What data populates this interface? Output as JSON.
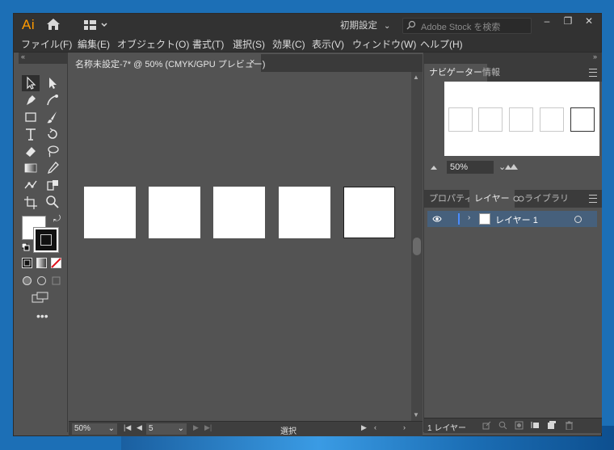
{
  "app": {
    "logo": "Ai",
    "workspace_preset": "初期設定",
    "search_placeholder": "Adobe Stock を検索"
  },
  "menu": [
    "ファイル(F)",
    "編集(E)",
    "オブジェクト(O)",
    "書式(T)",
    "選択(S)",
    "効果(C)",
    "表示(V)",
    "ウィンドウ(W)",
    "ヘルプ(H)"
  ],
  "document": {
    "tab_title": "名称未設定-7* @ 50% (CMYK/GPU プレビュー)",
    "close_glyph": "×"
  },
  "status": {
    "zoom": "50%",
    "artboard": "5",
    "mode": "選択"
  },
  "navigator": {
    "tabs": [
      "ナビゲーター",
      "情報"
    ],
    "zoom": "50%"
  },
  "layers_panel": {
    "tabs": [
      "プロパティ",
      "レイヤー",
      "ライブラリ"
    ],
    "layer_name": "レイヤー 1",
    "count": "1 レイヤー"
  },
  "window_controls": [
    "‒",
    "❐",
    "✕"
  ],
  "colors": {
    "accent": "#ff9a00",
    "layer_highlight": "#46607c",
    "layer_bar": "#4a8cff"
  }
}
